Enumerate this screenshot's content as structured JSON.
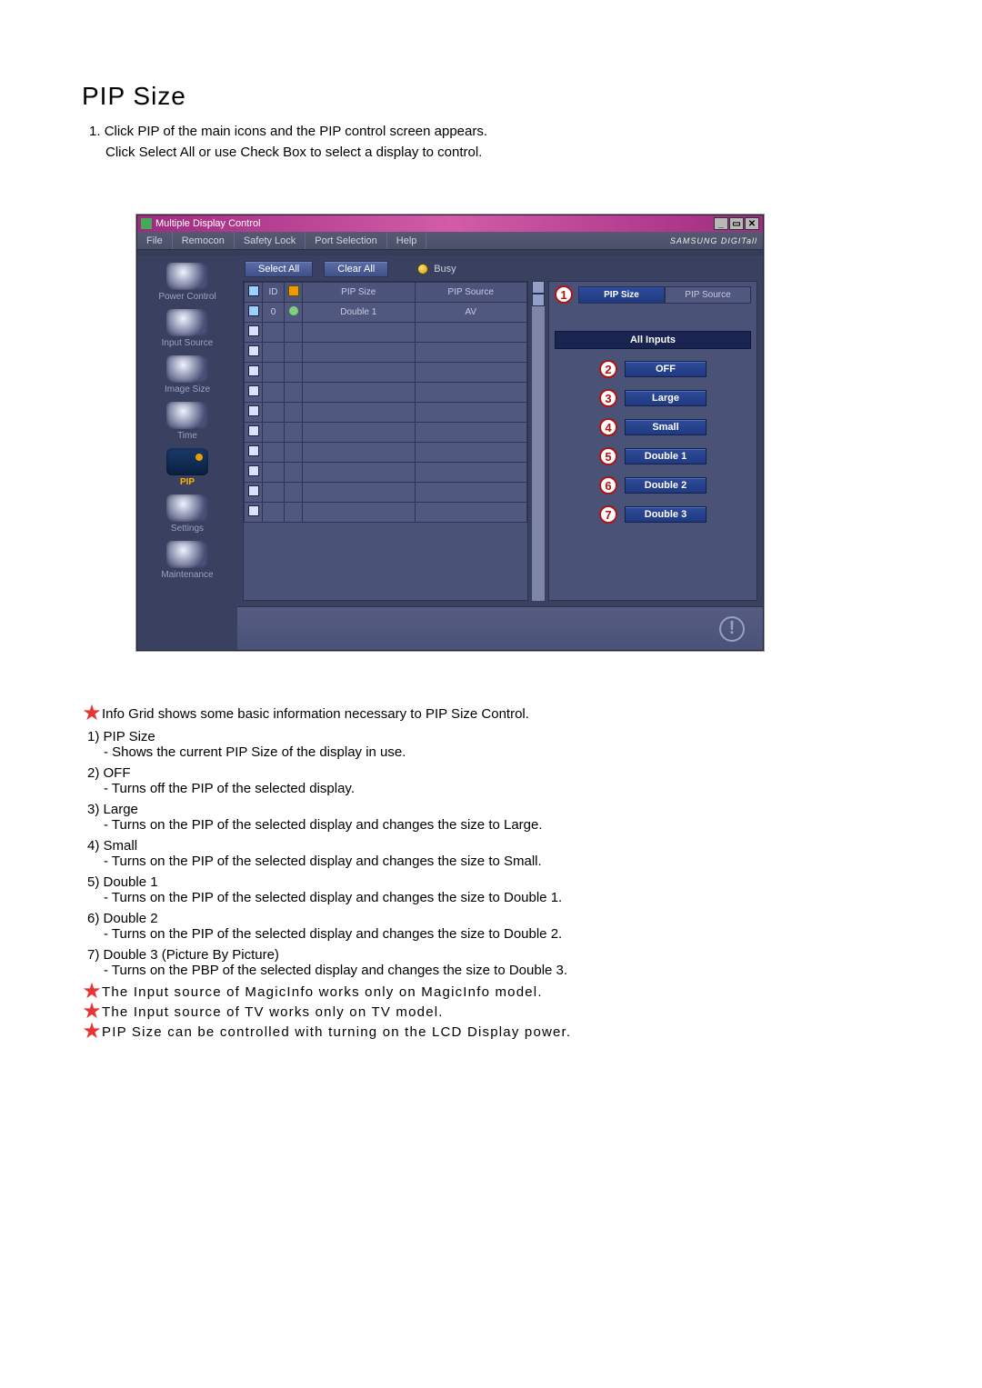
{
  "heading": "PIP Size",
  "intro_num": "1.",
  "intro_line1": "Click PIP of the main icons and the PIP control screen appears.",
  "intro_line2": "Click Select All or use Check Box to select a display to control.",
  "window": {
    "title": "Multiple Display Control",
    "win_minimize": "_",
    "win_restore": "▭",
    "win_close": "✕",
    "menus": [
      "File",
      "Remocon",
      "Safety Lock",
      "Port Selection",
      "Help"
    ],
    "brand": "SAMSUNG DIGITall",
    "toolbar": {
      "select_all": "Select All",
      "clear_all": "Clear All",
      "busy": "Busy"
    },
    "sidebar": [
      {
        "label": "Power Control"
      },
      {
        "label": "Input Source"
      },
      {
        "label": "Image Size"
      },
      {
        "label": "Time"
      },
      {
        "label": "PIP",
        "active": true
      },
      {
        "label": "Settings"
      },
      {
        "label": "Maintenance"
      }
    ],
    "grid": {
      "headers": {
        "chk": "☑",
        "id": "ID",
        "status": "●",
        "pip_size": "PIP Size",
        "pip_source": "PIP Source"
      },
      "row": {
        "id": "0",
        "pip_size": "Double 1",
        "pip_source": "AV"
      }
    },
    "panel": {
      "tabs": {
        "pip_size": "PIP Size",
        "pip_source": "PIP Source"
      },
      "callout_tab": "1",
      "all_inputs": "All Inputs",
      "options": [
        {
          "num": "2",
          "label": "OFF"
        },
        {
          "num": "3",
          "label": "Large"
        },
        {
          "num": "4",
          "label": "Small"
        },
        {
          "num": "5",
          "label": "Double 1"
        },
        {
          "num": "6",
          "label": "Double 2"
        },
        {
          "num": "7",
          "label": "Double 3"
        }
      ]
    },
    "footer_mark": "!"
  },
  "note_intro": "Info Grid shows some basic information necessary to PIP Size Control.",
  "items": [
    {
      "num": "1)",
      "title": "PIP Size",
      "desc": "- Shows the current PIP Size of the display in use."
    },
    {
      "num": "2)",
      "title": "OFF",
      "desc": "- Turns off the PIP of the selected display."
    },
    {
      "num": "3)",
      "title": "Large",
      "desc": "- Turns on the PIP of the selected display and changes the size to Large."
    },
    {
      "num": "4)",
      "title": "Small",
      "desc": "- Turns on the PIP of the selected display and changes the size to Small."
    },
    {
      "num": "5)",
      "title": "Double 1",
      "desc": "- Turns on the PIP of the selected display and changes the size to Double 1."
    },
    {
      "num": "6)",
      "title": "Double 2",
      "desc": "- Turns on the PIP of the selected display and changes the size to Double 2."
    },
    {
      "num": "7)",
      "title": "Double 3 (Picture By Picture)",
      "desc": "- Turns on the PBP of the selected display and changes the size to Double 3."
    }
  ],
  "star_notes": [
    "The Input source of MagicInfo works only on MagicInfo model.",
    "The Input source of TV works only on TV model.",
    "PIP Size can be controlled with turning on the LCD Display power."
  ]
}
